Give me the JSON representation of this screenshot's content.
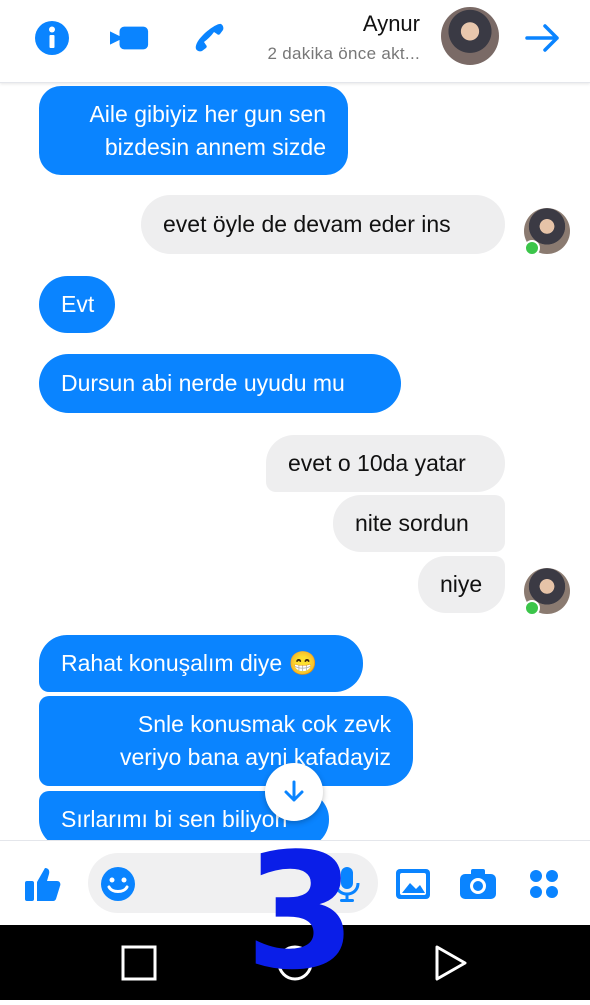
{
  "header": {
    "contact_name": "Aynur",
    "status": "2 dakika önce akt...",
    "icons": [
      "info-icon",
      "video-call-icon",
      "phone-icon",
      "forward-arrow-icon"
    ]
  },
  "messages": [
    {
      "side": "out",
      "text": "Aile gibiyiz her gun sen\nbizdesin annem sizde"
    },
    {
      "side": "in",
      "text": "evet öyle de devam eder ins"
    },
    {
      "side": "out",
      "text": "Evt"
    },
    {
      "side": "out",
      "text": "Dursun abi nerde uyudu mu"
    },
    {
      "side": "in",
      "text": "evet o 10da yatar"
    },
    {
      "side": "in",
      "text": "nite sordun"
    },
    {
      "side": "in",
      "text": "niye"
    },
    {
      "side": "out",
      "text": "Rahat konuşalım diye 😁"
    },
    {
      "side": "out",
      "text": "Snle konusmak cok zevk\nveriyo bana ayni kafadayiz"
    },
    {
      "side": "out",
      "text": "Sırlarımı bi sen biliyon"
    }
  ],
  "overlay_text": "3",
  "composer": {
    "icons": [
      "like-icon",
      "emoji-icon",
      "microphone-icon",
      "gallery-icon",
      "camera-icon",
      "apps-icon"
    ]
  },
  "colors": {
    "accent": "#0a84ff",
    "incoming": "#eeeeef",
    "overlay": "#0a1ee8",
    "online": "#3bc54a"
  }
}
